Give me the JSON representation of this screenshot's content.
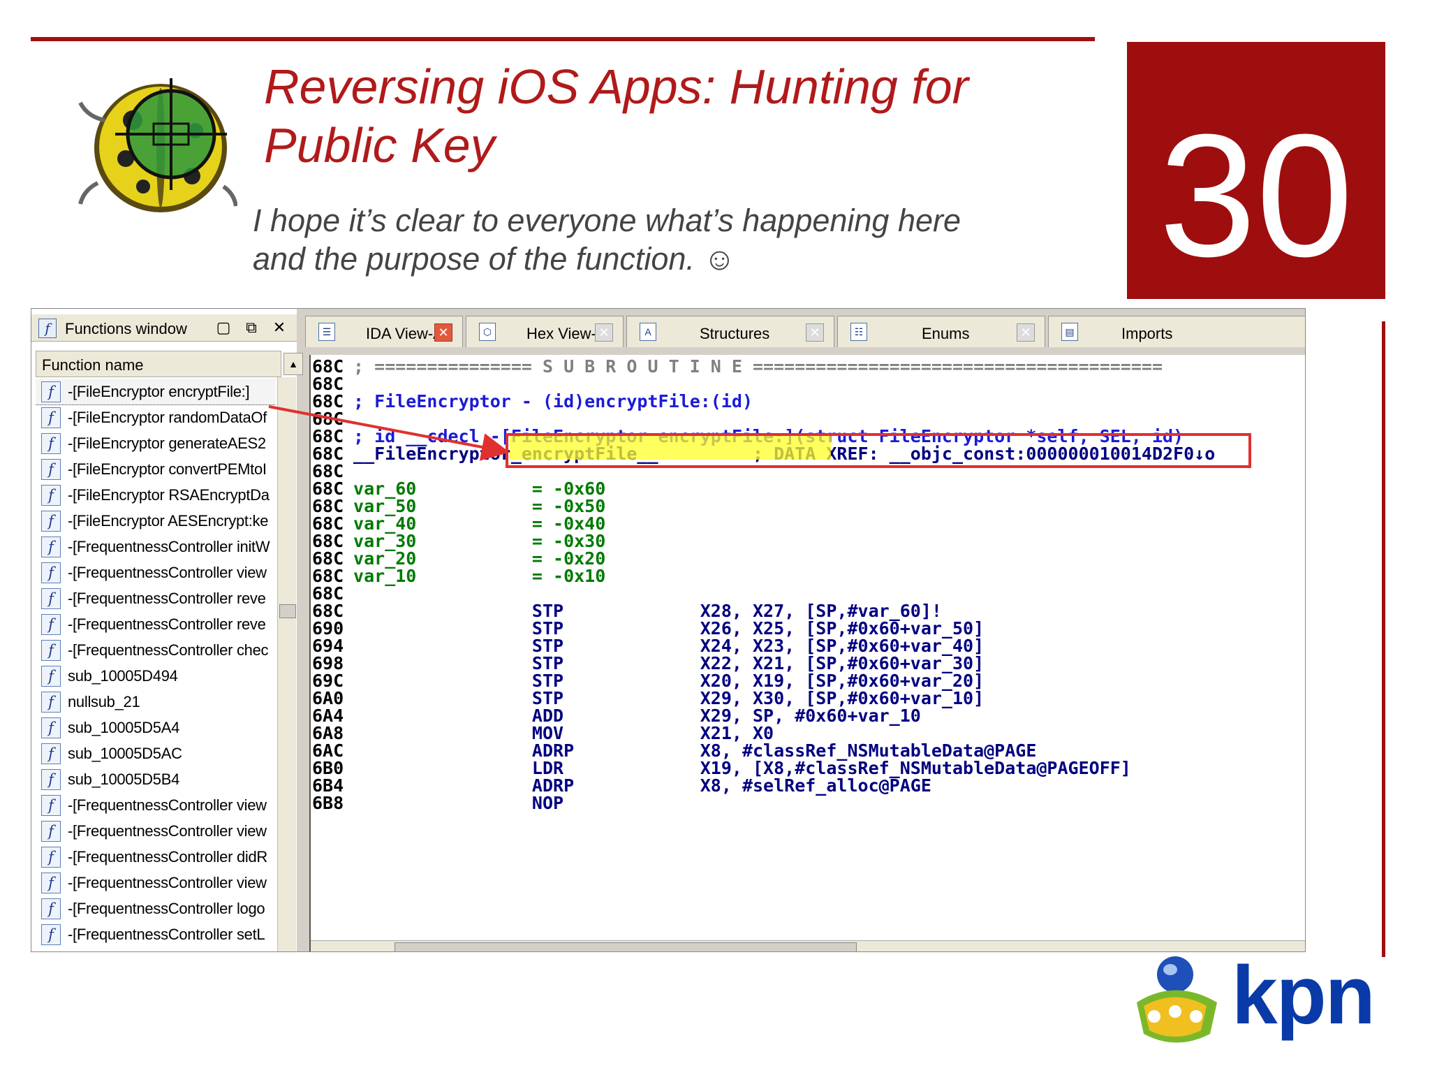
{
  "slide": {
    "title_line1": "Reversing iOS Apps: Hunting for",
    "title_line2": "Public Key",
    "subtitle_line1": "I hope it’s clear to everyone what’s happening here",
    "subtitle_line2": "and the purpose of the function. ☺",
    "slide_number": "30",
    "accent_color": "#a01010",
    "logo_text": "kpn"
  },
  "functions_window": {
    "title": "Functions window",
    "column_header": "Function name",
    "items": [
      "-[FileEncryptor encryptFile:]",
      "-[FileEncryptor randomDataOf",
      "-[FileEncryptor generateAES2",
      "-[FileEncryptor convertPEMtoI",
      "-[FileEncryptor RSAEncryptDa",
      "-[FileEncryptor AESEncrypt:ke",
      "-[FrequentnessController initW",
      "-[FrequentnessController view",
      "-[FrequentnessController reve",
      "-[FrequentnessController reve",
      "-[FrequentnessController chec",
      "sub_10005D494",
      "nullsub_21",
      "sub_10005D5A4",
      "sub_10005D5AC",
      "sub_10005D5B4",
      "-[FrequentnessController view",
      "-[FrequentnessController view",
      "-[FrequentnessController didR",
      "-[FrequentnessController view",
      "-[FrequentnessController logo",
      "-[FrequentnessController setL"
    ]
  },
  "tabs": [
    {
      "label": "IDA View-A",
      "icon": "ida-view-icon"
    },
    {
      "label": "Hex View-1",
      "icon": "hex-view-icon"
    },
    {
      "label": "Structures",
      "icon": "structures-icon"
    },
    {
      "label": "Enums",
      "icon": "enums-icon"
    },
    {
      "label": "Imports",
      "icon": "imports-icon"
    }
  ],
  "disassembly": {
    "lines": [
      {
        "addr": "68C",
        "text": " ; =============== S U B R O U T I N E =======================================",
        "cls": "c-gray"
      },
      {
        "addr": "68C",
        "text": "",
        "cls": "c-gray"
      },
      {
        "addr": "68C",
        "text": " ; FileEncryptor - (id)encryptFile:(id)",
        "cls": "c-blue"
      },
      {
        "addr": "68C",
        "text": "",
        "cls": "c-gray"
      },
      {
        "addr": "68C",
        "text": " ; id __cdecl -[FileEncryptor encryptFile:](struct FileEncryptor *self, SEL, id)",
        "cls": "c-blue"
      },
      {
        "addr": "68C",
        "text": " __FileEncryptor_encryptFile__         ; DATA XREF: __objc_const:000000010014D2F0↓o",
        "cls": "c-navy"
      },
      {
        "addr": "68C",
        "text": "",
        "cls": "c-gray"
      },
      {
        "addr": "68C",
        "text": " var_60           = -0x60",
        "cls": "c-green"
      },
      {
        "addr": "68C",
        "text": " var_50           = -0x50",
        "cls": "c-green"
      },
      {
        "addr": "68C",
        "text": " var_40           = -0x40",
        "cls": "c-green"
      },
      {
        "addr": "68C",
        "text": " var_30           = -0x30",
        "cls": "c-green"
      },
      {
        "addr": "68C",
        "text": " var_20           = -0x20",
        "cls": "c-green"
      },
      {
        "addr": "68C",
        "text": " var_10           = -0x10",
        "cls": "c-green"
      },
      {
        "addr": "68C",
        "text": "",
        "cls": "c-gray"
      },
      {
        "addr": "68C",
        "text": "                  STP             X28, X27, [SP,#var_60]!",
        "cls": "c-navy"
      },
      {
        "addr": "690",
        "text": "                  STP             X26, X25, [SP,#0x60+var_50]",
        "cls": "c-navy"
      },
      {
        "addr": "694",
        "text": "                  STP             X24, X23, [SP,#0x60+var_40]",
        "cls": "c-navy"
      },
      {
        "addr": "698",
        "text": "                  STP             X22, X21, [SP,#0x60+var_30]",
        "cls": "c-navy"
      },
      {
        "addr": "69C",
        "text": "                  STP             X20, X19, [SP,#0x60+var_20]",
        "cls": "c-navy"
      },
      {
        "addr": "6A0",
        "text": "                  STP             X29, X30, [SP,#0x60+var_10]",
        "cls": "c-navy"
      },
      {
        "addr": "6A4",
        "text": "                  ADD             X29, SP, #0x60+var_10",
        "cls": "c-navy"
      },
      {
        "addr": "6A8",
        "text": "                  MOV             X21, X0",
        "cls": "c-navy"
      },
      {
        "addr": "6AC",
        "text": "                  ADRP            X8, #classRef_NSMutableData@PAGE",
        "cls": "c-navy"
      },
      {
        "addr": "6B0",
        "text": "                  LDR             X19, [X8,#classRef_NSMutableData@PAGEOFF]",
        "cls": "c-navy"
      },
      {
        "addr": "6B4",
        "text": "                  ADRP            X8, #selRef_alloc@PAGE",
        "cls": "c-navy"
      },
      {
        "addr": "6B8",
        "text": "                  NOP",
        "cls": "c-navy"
      }
    ]
  }
}
